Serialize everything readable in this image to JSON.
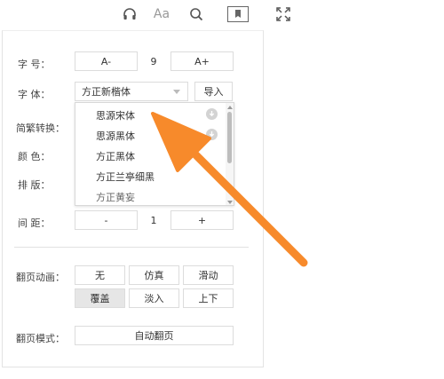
{
  "topbar": {
    "icons": [
      "headphones-icon",
      "font-size-icon",
      "search-icon",
      "bookmark-icon",
      "fullscreen-icon"
    ],
    "font_icon_text": "Aa"
  },
  "settings": {
    "font_size": {
      "label": "字  号：",
      "decrease": "A-",
      "value": "9",
      "increase": "A+"
    },
    "font_face": {
      "label": "字  体：",
      "selected": "方正新楷体",
      "import_button": "导入"
    },
    "font_options": [
      "思源宋体",
      "思源黑体",
      "方正黑体",
      "方正兰亭细黑",
      "方正黄妄"
    ],
    "simp_trad": {
      "label": "简繁转换："
    },
    "color": {
      "label": "颜  色："
    },
    "layout": {
      "label": "排  版："
    },
    "spacing": {
      "label": "间  距：",
      "decrease": "-",
      "value": "1",
      "increase": "+"
    },
    "page_animation": {
      "label": "翻页动画：",
      "options": [
        "无",
        "仿真",
        "滑动",
        "覆盖",
        "淡入",
        "上下"
      ],
      "selected": "覆盖"
    },
    "page_mode": {
      "label": "翻页模式：",
      "value": "自动翻页"
    }
  },
  "colors": {
    "annotation_arrow": "#f78a2b",
    "selected_bg": "#e6e6e6",
    "border": "#dcdcdc"
  }
}
